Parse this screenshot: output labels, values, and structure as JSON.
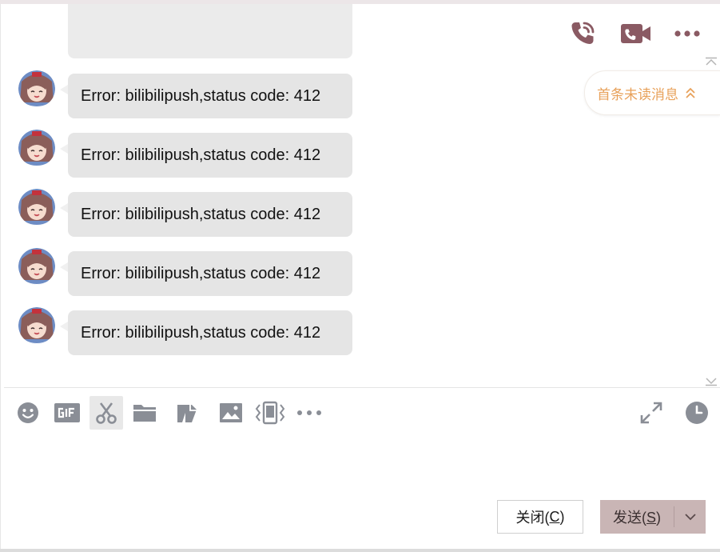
{
  "header": {
    "icons": [
      "phone-call-icon",
      "video-call-icon",
      "more-dots-icon"
    ]
  },
  "messages": [
    {
      "text": "Error: bilibilipush,status code: 412"
    },
    {
      "text": "Error: bilibilipush,status code: 412"
    },
    {
      "text": "Error: bilibilipush,status code: 412"
    },
    {
      "text": "Error: bilibilipush,status code: 412"
    },
    {
      "text": "Error: bilibilipush,status code: 412"
    }
  ],
  "unread": {
    "label": "首条未读消息"
  },
  "toolbar": {
    "left_icons": [
      "emoji-icon",
      "gif-icon",
      "scissors-icon",
      "folder-icon",
      "doc-icon",
      "image-icon",
      "shake-icon",
      "more-dots-icon"
    ],
    "right_icons": [
      "expand-icon",
      "clock-icon"
    ]
  },
  "footer": {
    "close_label": "关闭(",
    "close_key": "C",
    "close_end": ")",
    "send_label": "发送(",
    "send_key": "S",
    "send_end": ")"
  },
  "colors": {
    "accent_icon": "#8a5a63",
    "send_button": "#c9b5b5",
    "unread_text": "#e8a15a",
    "bubble": "#e5e5e5"
  }
}
